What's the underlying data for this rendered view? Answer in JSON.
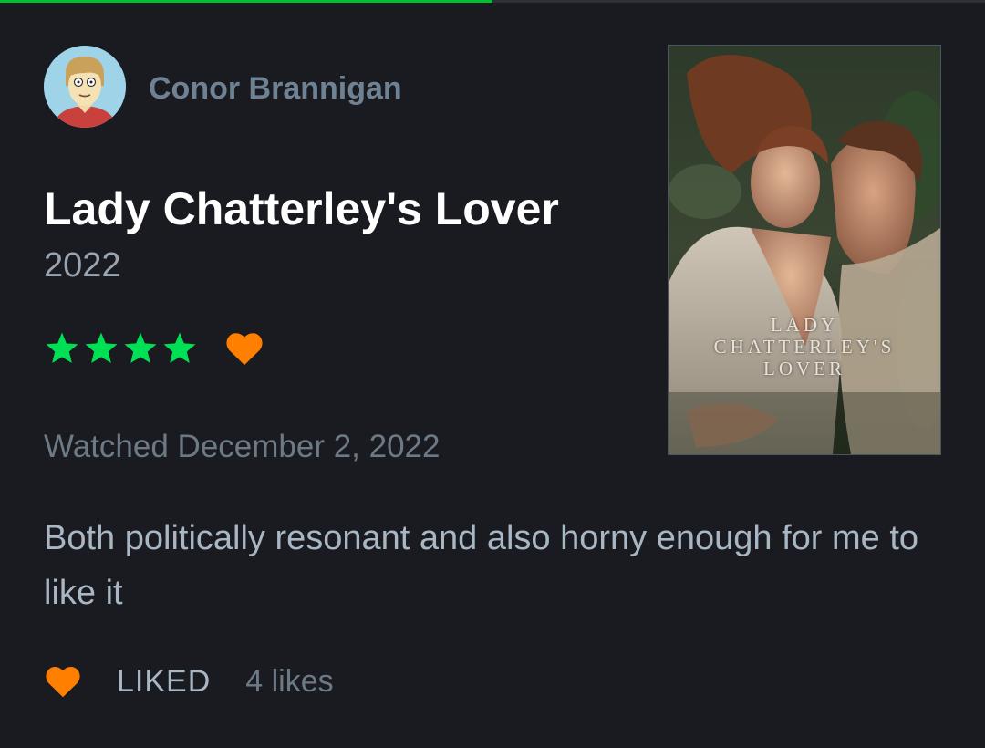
{
  "progress": {
    "fraction": 0.5,
    "color": "#00c030"
  },
  "author": {
    "name": "Conor Brannigan",
    "avatar_icon": "avatar-cartoon-face"
  },
  "film": {
    "title": "Lady Chatterley's Lover",
    "year": "2022",
    "poster": {
      "title_lines": [
        "LADY",
        "CHATTERLEY'S",
        "LOVER"
      ]
    }
  },
  "rating": {
    "stars": 4,
    "max_stars": 5,
    "liked": true,
    "star_color": "#00e054",
    "heart_color": "#ff8000"
  },
  "watched": {
    "text": "Watched December 2, 2022"
  },
  "review": {
    "text": "Both politically resonant and also horny enough for me to like it"
  },
  "footer": {
    "like_icon": "heart-icon",
    "liked_label": "LIKED",
    "likes_count": "4 likes"
  },
  "colors": {
    "background": "#191b20",
    "title": "#ffffff",
    "author": "#6f8294",
    "muted": "#6d7a86",
    "body": "#a9b6c3",
    "accent_heart": "#ff8000",
    "accent_star": "#00e054"
  }
}
